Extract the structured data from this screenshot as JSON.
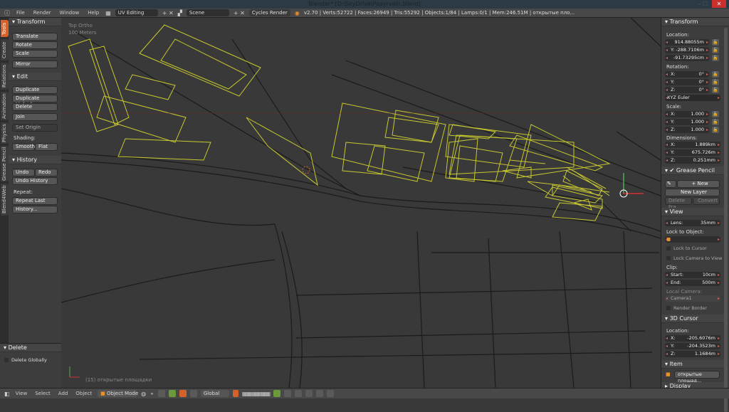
{
  "window": {
    "title": "Blender* [D:\\SkyDrive\\Papyrvaln.blend]",
    "close": "✕",
    "minmax": "–  ☐"
  },
  "topbar": {
    "menus": [
      "File",
      "Render",
      "Window",
      "Help"
    ],
    "layout": "UV Editing",
    "scene": "Scene",
    "engine": "Cycles Render",
    "stats": "v2.70 | Verts:52722 | Faces:26949 | Tris:55292 | Objects:1/84 | Lamps:0/1 | Mem:246.51M | открытые пло..."
  },
  "tabs": [
    "Tools",
    "Create",
    "Relations",
    "Animation",
    "Physics",
    "Grease Pencil",
    "Blend4Web"
  ],
  "tools": {
    "transform": "Transform",
    "translate": "Translate",
    "rotate": "Rotate",
    "scale": "Scale",
    "mirror": "Mirror",
    "edit": "Edit",
    "duplicate": "Duplicate",
    "duplicate_linked": "Duplicate Linked",
    "delete": "Delete",
    "join": "Join",
    "set_origin": "Set Origin",
    "shading": "Shading:",
    "smooth": "Smooth",
    "flat": "Flat",
    "history": "History",
    "undo": "Undo",
    "redo": "Redo",
    "undo_history": "Undo History",
    "repeat": "Repeat:",
    "repeat_last": "Repeat Last",
    "history_btn": "History..."
  },
  "operator": {
    "title": "Delete",
    "delete_globally": "Delete Globally"
  },
  "viewport": {
    "view_name": "Top Ortho",
    "scale": "100 Meters",
    "object_info": "(15) открытые площадки",
    "selection_color": "#d4d42a"
  },
  "right": {
    "transform": "Transform",
    "location": "Location:",
    "loc": [
      {
        "k": "",
        "v": "914.88055m"
      },
      {
        "k": "Y:",
        "v": "-288.7106m"
      },
      {
        "k": "",
        "v": "-91.73295cm"
      }
    ],
    "rotation": "Rotation:",
    "rot": [
      {
        "k": "X:",
        "v": "0°"
      },
      {
        "k": "Y:",
        "v": "0°"
      },
      {
        "k": "Z:",
        "v": "0°"
      }
    ],
    "rot_mode": "XYZ Euler",
    "scale": "Scale:",
    "scl": [
      {
        "k": "X:",
        "v": "1.000"
      },
      {
        "k": "Y:",
        "v": "1.000"
      },
      {
        "k": "Z:",
        "v": "1.000"
      }
    ],
    "dimensions": "Dimensions:",
    "dim": [
      {
        "k": "X:",
        "v": "1.889km"
      },
      {
        "k": "Y:",
        "v": "675.726m"
      },
      {
        "k": "Z:",
        "v": "0.251mm"
      }
    ],
    "grease_pencil": "Grease Pencil",
    "new": "New",
    "new_layer": "New Layer",
    "delete_frame": "Delete Fra...",
    "convert": "Convert",
    "view": "View",
    "lens_k": "Lens:",
    "lens_v": "35mm",
    "lock_to_object": "Lock to Object:",
    "lock_to_cursor": "Lock to Cursor",
    "lock_camera": "Lock Camera to View",
    "clip": "Clip:",
    "start_k": "Start:",
    "start_v": "10cm",
    "end_k": "End:",
    "end_v": "500m",
    "local_camera": "Local Camera:",
    "camera": "Camera1",
    "render_border": "Render Border",
    "cursor": "3D Cursor",
    "cursor_location": "Location:",
    "cur": [
      {
        "k": "X:",
        "v": "-205.6076m"
      },
      {
        "k": "Y:",
        "v": "-204.3523m"
      },
      {
        "k": "Z:",
        "v": "1.1684m"
      }
    ],
    "item": "Item",
    "item_name": "открытые площад...",
    "display": "Display"
  },
  "bottombar": {
    "menus": [
      "View",
      "Select",
      "Add",
      "Object"
    ],
    "mode": "Object Mode",
    "orientation": "Global"
  }
}
